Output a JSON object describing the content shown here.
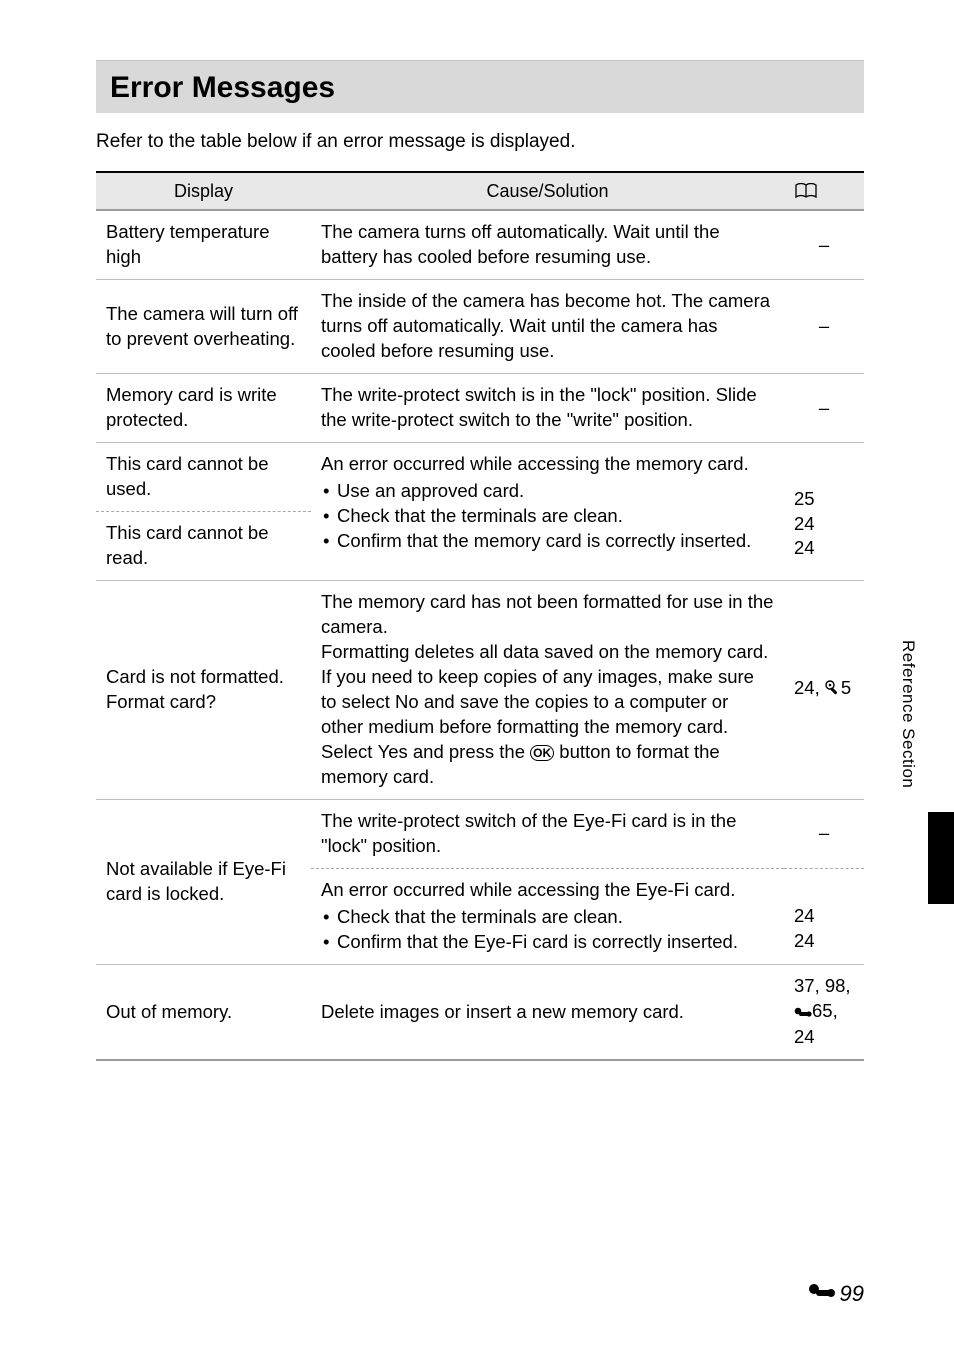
{
  "title": "Error Messages",
  "intro": "Refer to the table below if an error message is displayed.",
  "columns": {
    "display": "Display",
    "cause": "Cause/Solution"
  },
  "side_label": "Reference Section",
  "page_number": "99",
  "rows": {
    "r1": {
      "display": "Battery temperature high",
      "cause": "The camera turns off automatically. Wait until the battery has cooled before resuming use.",
      "ref": "–"
    },
    "r2": {
      "display": "The camera will turn off to prevent overheating.",
      "cause": "The inside of the camera has become hot. The camera turns off automatically. Wait until the camera has cooled before resuming use.",
      "ref": "–"
    },
    "r3": {
      "display": "Memory card is write protected.",
      "cause": "The write-protect switch is in the \"lock\" position. Slide the write-protect switch to the \"write\" position.",
      "ref": "–"
    },
    "r4a": {
      "display": "This card cannot be used."
    },
    "r4b": {
      "display": "This card cannot be read."
    },
    "r4": {
      "cause_lead": "An error occurred while accessing the memory card.",
      "bullets": [
        "Use an approved card.",
        "Check that the terminals are clean.",
        "Confirm that the memory card is correctly inserted."
      ],
      "ref_lines": [
        "25",
        "24",
        "24"
      ]
    },
    "r5": {
      "display": "Card is not formatted. Format card?",
      "cause_p1": "The memory card has not been formatted for use in the camera.",
      "cause_p2a": "Formatting deletes all data saved on the memory card. If you need to keep copies of any images, make sure to select ",
      "cause_no": "No",
      "cause_p2b": " and save the copies to a computer or other medium before formatting the memory card. Select ",
      "cause_yes": "Yes",
      "cause_p2c": " and press the ",
      "cause_p2d": " button to format the memory card.",
      "ref_a": "24, ",
      "ref_b": "5"
    },
    "r6a": {
      "cause": "The write-protect switch of the Eye-Fi card is in the \"lock\" position.",
      "ref": "–"
    },
    "r6": {
      "display": "Not available if Eye-Fi card is locked.",
      "cause_lead": "An error occurred while accessing the Eye-Fi card.",
      "bullets": [
        "Check that the terminals are clean.",
        "Confirm that the Eye-Fi card is correctly inserted."
      ],
      "ref_lines": [
        "24",
        "24"
      ]
    },
    "r7": {
      "display": "Out of memory.",
      "cause": "Delete images or insert a new memory card.",
      "ref_a": "37, 98,",
      "ref_b": "65,",
      "ref_c": "24"
    }
  }
}
